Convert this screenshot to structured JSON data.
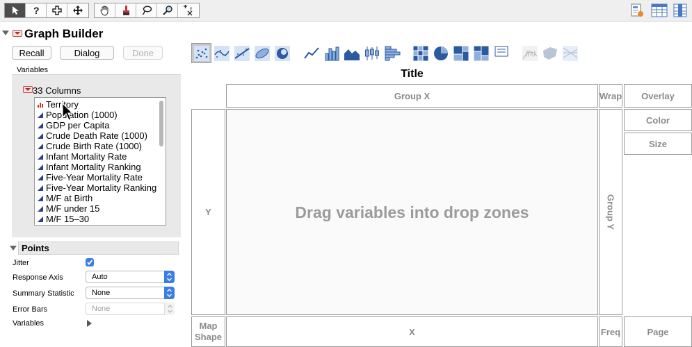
{
  "toolbar": {
    "tools": [
      "arrow-tool",
      "help-tool",
      "selection-tool",
      "move-tool",
      "grabber-tool",
      "brush-tool",
      "lasso-tool",
      "magnifier-tool",
      "crosshair-tool"
    ]
  },
  "app": {
    "title": "Graph Builder"
  },
  "buttons": {
    "recall": "Recall",
    "dialog": "Dialog",
    "done": "Done"
  },
  "variables": {
    "section_label": "Variables",
    "columns_title": "33 Columns",
    "columns": [
      {
        "name": "Territory",
        "type": "nominal"
      },
      {
        "name": "Population (1000)",
        "type": "continuous"
      },
      {
        "name": "GDP per Capita",
        "type": "continuous"
      },
      {
        "name": "Crude Death Rate (1000)",
        "type": "continuous"
      },
      {
        "name": "Crude Birth Rate (1000)",
        "type": "continuous"
      },
      {
        "name": "Infant Mortality Rate",
        "type": "continuous"
      },
      {
        "name": "Infant Mortality Ranking",
        "type": "continuous"
      },
      {
        "name": "Five-Year Mortality Rate",
        "type": "continuous"
      },
      {
        "name": "Five-Year Mortality Ranking",
        "type": "continuous"
      },
      {
        "name": "M/F at Birth",
        "type": "continuous"
      },
      {
        "name": "M/F under 15",
        "type": "continuous"
      },
      {
        "name": "M/F 15–30",
        "type": "continuous"
      }
    ]
  },
  "points": {
    "header": "Points",
    "jitter_label": "Jitter",
    "jitter_checked": true,
    "response_axis_label": "Response Axis",
    "response_axis_value": "Auto",
    "summary_statistic_label": "Summary Statistic",
    "summary_statistic_value": "None",
    "error_bars_label": "Error Bars",
    "error_bars_value": "None",
    "variables_label": "Variables"
  },
  "graph": {
    "title": "Title",
    "drop_message": "Drag variables into drop zones",
    "zones": {
      "group_x": "Group X",
      "wrap": "Wrap",
      "overlay": "Overlay",
      "color": "Color",
      "size": "Size",
      "y": "Y",
      "group_y": "Group Y",
      "map_shape_1": "Map",
      "map_shape_2": "Shape",
      "x": "X",
      "freq": "Freq",
      "page": "Page"
    }
  },
  "colors": {
    "accent": "#3a7ee6",
    "disclosure_red": "#d12020",
    "zone_text": "#8a8a8a"
  }
}
